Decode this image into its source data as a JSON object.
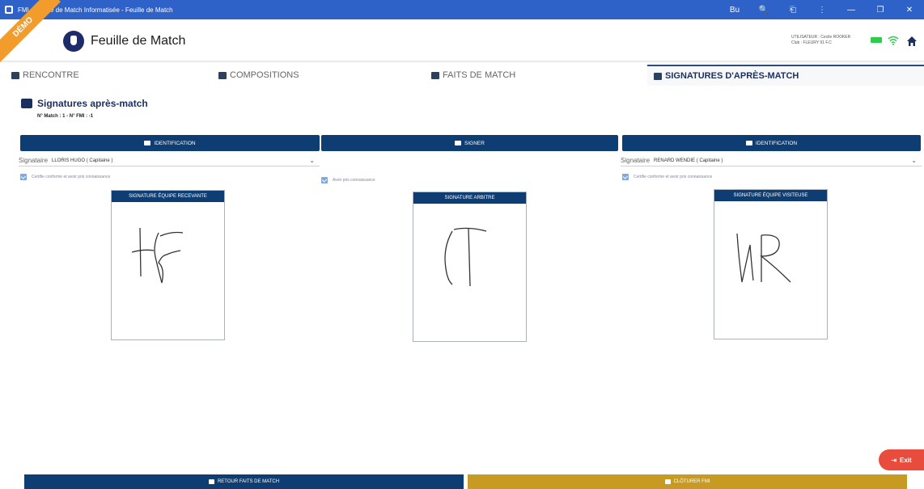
{
  "window": {
    "title": "FMI - Feuille de Match Informatisée - Feuille de Match",
    "controls": [
      "Bu",
      "🔍",
      "⎗",
      "⋮",
      "—",
      "❐",
      "✕"
    ]
  },
  "appbar": {
    "ribbon": "DÉMO",
    "title": "Feuille de Match",
    "user_line1": "UTILISATEUR : Cecile ROOKER",
    "user_line2": "Club : FLEURY 91 F.C",
    "icons": [
      "battery-icon",
      "wifi-icon",
      "home-icon"
    ]
  },
  "tabs": [
    {
      "label": "RENCONTRE",
      "icon": "vs-icon",
      "active": false
    },
    {
      "label": "COMPOSITIONS",
      "icon": "shirt-icon",
      "active": false
    },
    {
      "label": "FAITS DE MATCH",
      "icon": "list-icon",
      "active": false
    },
    {
      "label": "SIGNATURES D'APRÈS-MATCH",
      "icon": "signature-icon",
      "active": true
    }
  ],
  "section": {
    "title": "Signatures après-match",
    "match_info": "N° Match : 1 - N° FMI : -1"
  },
  "columns": [
    {
      "button": "IDENTIFICATION",
      "signataire_label": "Signataire",
      "signataire_value": "LLORIS HUGO ( Capitaine )",
      "check_label": "Certifie conforme et avoir pris connaissance",
      "pad_title": "SIGNATURE ÉQUIPE RECEVANTE"
    },
    {
      "button": "SIGNER",
      "check_label": "Avoir pris connaissance",
      "pad_title": "SIGNATURE ARBITRE"
    },
    {
      "button": "IDENTIFICATION",
      "signataire_label": "Signataire",
      "signataire_value": "RENARD WENDIE ( Capitaine )",
      "check_label": "Certifie conforme et avoir pris connaissance",
      "pad_title": "SIGNATURE ÉQUIPE VISITEUSE"
    }
  ],
  "footer": {
    "back_label": "RETOUR FAITS DE MATCH",
    "close_label": "CLÔTURER FMI",
    "exit_label": "Exit"
  },
  "colors": {
    "titlebar": "#2f62c9",
    "primary": "#0e3d73",
    "gold": "#c79a22",
    "exit": "#e74c3c",
    "ribbon": "#f29c2b"
  }
}
